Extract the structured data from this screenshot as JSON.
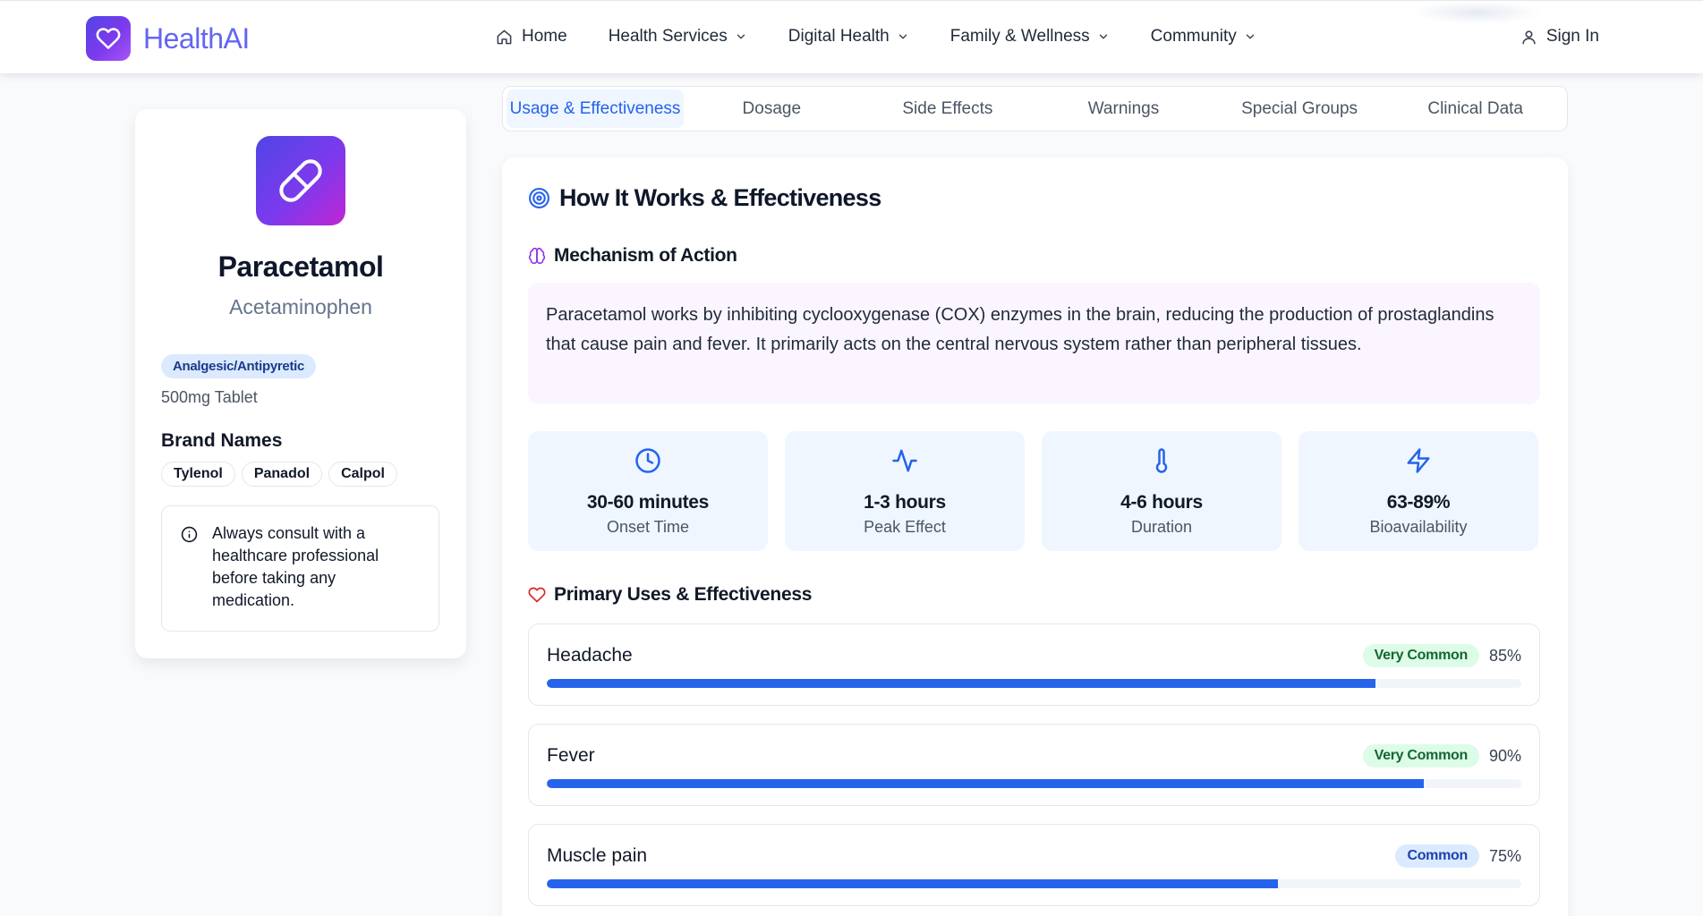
{
  "header": {
    "brand": "HealthAI",
    "nav": [
      {
        "label": "Home",
        "icon": "home-icon"
      },
      {
        "label": "Health Services",
        "icon": "chevron-down-icon"
      },
      {
        "label": "Digital Health",
        "icon": "chevron-down-icon"
      },
      {
        "label": "Family & Wellness",
        "icon": "chevron-down-icon"
      },
      {
        "label": "Community",
        "icon": "chevron-down-icon"
      }
    ],
    "sign_in": "Sign In",
    "accent_color": "#6366f1"
  },
  "drug": {
    "name": "Paracetamol",
    "generic": "Acetaminophen",
    "class": "Analgesic/Antipyretic",
    "form": "500mg Tablet",
    "brand_names_title": "Brand Names",
    "brand_names": [
      "Tylenol",
      "Panadol",
      "Calpol"
    ],
    "consult_notice": "Always consult with a healthcare professional before taking any medication."
  },
  "tabs": [
    {
      "label": "Usage & Effectiveness",
      "active": true
    },
    {
      "label": "Dosage",
      "active": false
    },
    {
      "label": "Side Effects",
      "active": false
    },
    {
      "label": "Warnings",
      "active": false
    },
    {
      "label": "Special Groups",
      "active": false
    },
    {
      "label": "Clinical Data",
      "active": false
    }
  ],
  "main": {
    "title": "How It Works & Effectiveness",
    "mechanism_title": "Mechanism of Action",
    "mechanism_text": "Paracetamol works by inhibiting cyclooxygenase (COX) enzymes in the brain, reducing the production of prostaglandins that cause pain and fever. It primarily acts on the central nervous system rather than peripheral tissues.",
    "stats": [
      {
        "value": "30-60 minutes",
        "label": "Onset Time",
        "icon": "clock-icon"
      },
      {
        "value": "1-3 hours",
        "label": "Peak Effect",
        "icon": "activity-icon"
      },
      {
        "value": "4-6 hours",
        "label": "Duration",
        "icon": "thermometer-icon"
      },
      {
        "value": "63-89%",
        "label": "Bioavailability",
        "icon": "lightning-icon"
      }
    ],
    "uses_title": "Primary Uses & Effectiveness",
    "uses": [
      {
        "name": "Headache",
        "frequency": "Very Common",
        "percent_label": "85%",
        "percent": 85
      },
      {
        "name": "Fever",
        "frequency": "Very Common",
        "percent_label": "90%",
        "percent": 90
      },
      {
        "name": "Muscle pain",
        "frequency": "Common",
        "percent_label": "75%",
        "percent": 75
      }
    ]
  },
  "colors": {
    "primary": "#2563eb",
    "very_common_bg": "#dcfce7",
    "common_bg": "#dbeafe",
    "mechanism_bg": "#faf5ff",
    "stat_bg": "#eff6ff"
  }
}
